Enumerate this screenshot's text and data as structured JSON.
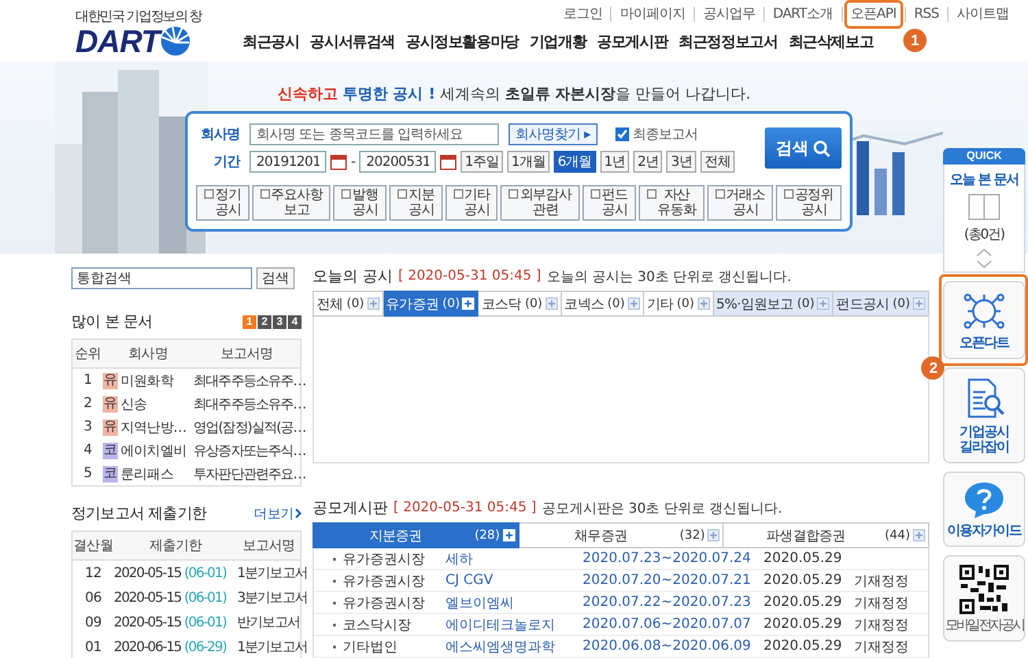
{
  "header": {
    "logo": {
      "tagline": "대한민국 기업정보의 창",
      "text": "DART"
    },
    "top_links": [
      {
        "label": "로그인"
      },
      {
        "label": "마이페이지"
      },
      {
        "label": "공시업무"
      },
      {
        "label": "DART소개"
      },
      {
        "label": "오픈API",
        "annotation": "1"
      },
      {
        "label": "RSS"
      },
      {
        "label": "사이트맵"
      }
    ],
    "nav": [
      "최근공시",
      "공시서류검색",
      "공시정보활용마당",
      "기업개황",
      "공모게시판",
      "최근정정보고서",
      "최근삭제보고"
    ]
  },
  "banner": {
    "slogan": "**신속하고** **투명한 공시 !** 세계속의 **초일류** **자본시장**을 만들어 나갑니다."
  },
  "search": {
    "company_label": "회사명",
    "company_placeholder": "회사명 또는 종목코드를 입력하세요",
    "find_button": "회사명찾기 ▸",
    "final_report": {
      "label": "최종보고서",
      "checked": true
    },
    "period_label": "기간",
    "date_from": "20191201",
    "date_separator": "-",
    "date_to": "20200531",
    "period_buttons": [
      {
        "label": "1주일",
        "selected": false
      },
      {
        "label": "1개월",
        "selected": false
      },
      {
        "label": "6개월",
        "selected": true
      },
      {
        "label": "1년",
        "selected": false
      },
      {
        "label": "2년",
        "selected": false
      },
      {
        "label": "3년",
        "selected": false
      },
      {
        "label": "전체",
        "selected": false
      }
    ],
    "search_button": "검색",
    "categories": [
      {
        "lines": [
          "정기",
          "공시"
        ],
        "checked": false
      },
      {
        "lines": [
          "주요사항",
          "보고"
        ],
        "checked": false
      },
      {
        "lines": [
          "발행",
          "공시"
        ],
        "checked": false
      },
      {
        "lines": [
          "지분",
          "공시"
        ],
        "checked": false
      },
      {
        "lines": [
          "기타",
          "공시"
        ],
        "checked": false
      },
      {
        "lines": [
          "외부감사",
          "관련"
        ],
        "checked": false
      },
      {
        "lines": [
          "펀드",
          "공시"
        ],
        "checked": false
      },
      {
        "lines": [
          "자산",
          "유동화"
        ],
        "checked": false
      },
      {
        "lines": [
          "거래소",
          "공시"
        ],
        "checked": false
      },
      {
        "lines": [
          "공정위",
          "공시"
        ],
        "checked": false
      }
    ]
  },
  "left": {
    "search": {
      "value": "통합검색",
      "button": "검색"
    },
    "popular": {
      "title": "많이 본 문서",
      "pages": [
        {
          "label": "1",
          "selected": true
        },
        {
          "label": "2",
          "selected": false
        },
        {
          "label": "3",
          "selected": false
        },
        {
          "label": "4",
          "selected": false
        }
      ],
      "columns": [
        "순위",
        "회사명",
        "보고서명"
      ],
      "rows": [
        {
          "rank": "1",
          "market": "유",
          "color": "#f0b4a4",
          "company": "미원화학",
          "report": "최대주주등소유주…"
        },
        {
          "rank": "2",
          "market": "유",
          "color": "#f0b4a4",
          "company": "신송",
          "report": "최대주주등소유주…"
        },
        {
          "rank": "3",
          "market": "유",
          "color": "#f0b4a4",
          "company": "지역난방…",
          "report": "영업(잠정)실적(공…"
        },
        {
          "rank": "4",
          "market": "코",
          "color": "#b8b4ec",
          "company": "에이치엘비",
          "report": "유상증자또는주식…"
        },
        {
          "rank": "5",
          "market": "코",
          "color": "#b8b4ec",
          "company": "룬리패스",
          "report": "투자판단관련주요…"
        }
      ]
    },
    "deadlines": {
      "title": "정기보고서 제출기한",
      "more": "더보기",
      "columns": [
        "결산월",
        "제출기한",
        "보고서명"
      ],
      "rows": [
        {
          "month": "12",
          "date": "2020-05-15",
          "due": "(06-01)",
          "report": "1분기보고서"
        },
        {
          "month": "06",
          "date": "2020-05-15",
          "due": "(06-01)",
          "report": "3분기보고서"
        },
        {
          "month": "09",
          "date": "2020-05-15",
          "due": "(06-01)",
          "report": "반기보고서"
        },
        {
          "month": "01",
          "date": "2020-06-15",
          "due": "(06-29)",
          "report": "1분기보고서"
        }
      ]
    }
  },
  "today": {
    "title": "오늘의 공시",
    "time": "[ 2020-05-31 05:45 ]",
    "note": "오늘의 공시는 30초 단위로 갱신됩니다.",
    "tabs": [
      {
        "label": "전체",
        "count": "(0)",
        "selected": false,
        "highlighted": false
      },
      {
        "label": "유가증권",
        "count": "(0)",
        "selected": true,
        "highlighted": false
      },
      {
        "label": "코스닥",
        "count": "(0)",
        "selected": false,
        "highlighted": false
      },
      {
        "label": "코넥스",
        "count": "(0)",
        "selected": false,
        "highlighted": false
      },
      {
        "label": "기타",
        "count": "(0)",
        "selected": false,
        "highlighted": false
      },
      {
        "label": "5%·임원보고",
        "count": "(0)",
        "selected": false,
        "highlighted": true
      },
      {
        "label": "펀드공시",
        "count": "(0)",
        "selected": false,
        "highlighted": true
      }
    ]
  },
  "board": {
    "title": "공모게시판",
    "time": "[ 2020-05-31 05:45 ]",
    "note": "공모게시판은 30초 단위로 갱신됩니다.",
    "tabs": [
      {
        "label": "지분증권",
        "count": "(28)",
        "selected": true
      },
      {
        "label": "채무증권",
        "count": "(32)",
        "selected": false
      },
      {
        "label": "파생결합증권",
        "count": "(44)",
        "selected": false
      }
    ],
    "rows": [
      {
        "market": "유가증권시장",
        "company": "세하",
        "period": "2020.07.23~2020.07.24",
        "date": "2020.05.29"
      },
      {
        "market": "유가증권시장",
        "company": "CJ CGV",
        "period": "2020.07.20~2020.07.21",
        "date": "2020.05.29",
        "note": "기재정정"
      },
      {
        "market": "유가증권시장",
        "company": "엘브이엠씨",
        "period": "2020.07.22~2020.07.23",
        "date": "2020.05.29",
        "note": "기재정정"
      },
      {
        "market": "코스닥시장",
        "company": "에이디테크놀로지",
        "period": "2020.07.06~2020.07.07",
        "date": "2020.05.29",
        "note": "기재정정"
      },
      {
        "market": "기타법인",
        "company": "에스씨엠생명과학",
        "period": "2020.06.08~2020.06.09",
        "date": "2020.05.29",
        "note": "기재정정"
      }
    ]
  },
  "quick": {
    "title": "QUICK",
    "recent_title": "오늘 본 문서",
    "recent_count": "(총0건)",
    "items": [
      {
        "kind": "api",
        "lines": [
          "오픈다트"
        ],
        "annotation": "2"
      },
      {
        "kind": "guide",
        "lines": [
          "기업공시",
          "길라잡이"
        ]
      },
      {
        "kind": "help",
        "lines": [
          "이용자가이드"
        ]
      },
      {
        "kind": "qr",
        "lines": [
          "모바일전자공시"
        ]
      }
    ]
  }
}
